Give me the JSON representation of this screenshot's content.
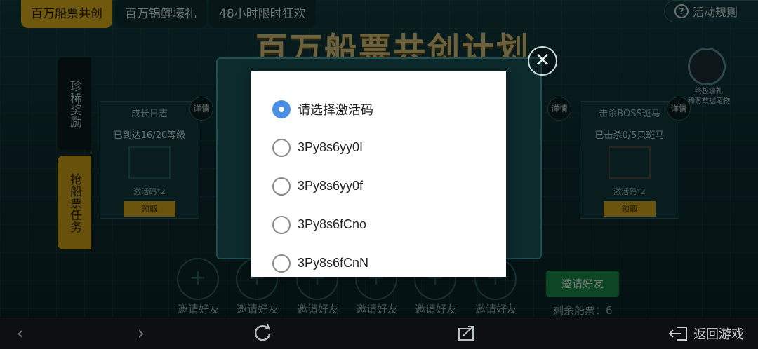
{
  "top_tabs": [
    "百万船票共创",
    "百万锦鲤壕礼",
    "48小时限时狂欢"
  ],
  "rules_label": "活动规则",
  "page_title": "百万船票共创计划",
  "side_tabs": [
    "珍稀奖励",
    "抢船票任务"
  ],
  "detail_label": "详情",
  "cards": [
    {
      "title": "成长日志",
      "desc": "已到达16/20等级",
      "reward": "激活码*2",
      "button": "领取"
    },
    {
      "title": "击杀BOSS斑马",
      "desc": "已击杀0/5只斑马",
      "reward": "激活码*2",
      "button": "领取"
    }
  ],
  "right_icon_label": "终极壕礼\n稀有数据宠物",
  "invite_slot_label": "邀请好友",
  "invite_button": "邀请好友",
  "remaining": "剩余船票：6",
  "dialog": {
    "options": [
      {
        "label": "请选择激活码",
        "checked": true
      },
      {
        "label": "3Py8s6yy0I",
        "checked": false
      },
      {
        "label": "3Py8s6yy0f",
        "checked": false
      },
      {
        "label": "3Py8s6fCno",
        "checked": false
      },
      {
        "label": "3Py8s6fCnN",
        "checked": false
      }
    ]
  },
  "navbar": {
    "back_game_label": "返回游戏",
    "icons": [
      "back-arrow-icon",
      "forward-arrow-icon",
      "refresh-icon",
      "share-icon",
      "exit-icon"
    ]
  },
  "colors": {
    "accent_yellow": "#e0b219",
    "radio_blue": "#4a90e2",
    "invite_green": "#1a8c4a"
  }
}
